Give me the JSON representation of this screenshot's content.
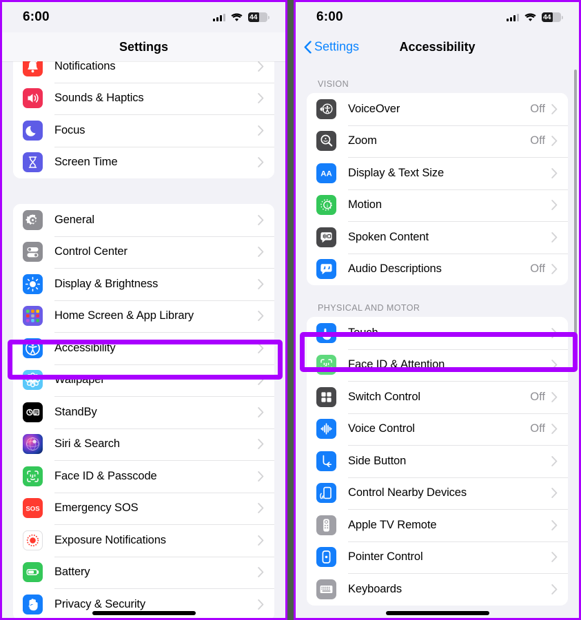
{
  "status_bar": {
    "time": "6:00",
    "battery_percent": "44",
    "signal_icon": "cellular-signal-icon",
    "wifi_icon": "wifi-icon",
    "battery_icon": "battery-icon"
  },
  "left_panel": {
    "title": "Settings",
    "highlighted_row": "Accessibility",
    "groups": [
      {
        "id": "group-notifications",
        "rows": [
          {
            "label": "Notifications",
            "icon": "bell-icon",
            "value": ""
          },
          {
            "label": "Sounds & Haptics",
            "icon": "speaker-icon",
            "value": ""
          },
          {
            "label": "Focus",
            "icon": "moon-icon",
            "value": ""
          },
          {
            "label": "Screen Time",
            "icon": "hourglass-icon",
            "value": ""
          }
        ]
      },
      {
        "id": "group-general",
        "rows": [
          {
            "label": "General",
            "icon": "gear-icon",
            "value": ""
          },
          {
            "label": "Control Center",
            "icon": "toggles-icon",
            "value": ""
          },
          {
            "label": "Display & Brightness",
            "icon": "sun-icon",
            "value": ""
          },
          {
            "label": "Home Screen & App Library",
            "icon": "app-grid-icon",
            "value": ""
          },
          {
            "label": "Accessibility",
            "icon": "accessibility-icon",
            "value": ""
          },
          {
            "label": "Wallpaper",
            "icon": "flower-icon",
            "value": ""
          },
          {
            "label": "StandBy",
            "icon": "standby-icon",
            "value": ""
          },
          {
            "label": "Siri & Search",
            "icon": "siri-icon",
            "value": ""
          },
          {
            "label": "Face ID & Passcode",
            "icon": "faceid-icon",
            "value": ""
          },
          {
            "label": "Emergency SOS",
            "icon": "sos-icon",
            "value": ""
          },
          {
            "label": "Exposure Notifications",
            "icon": "exposure-icon",
            "value": ""
          },
          {
            "label": "Battery",
            "icon": "battery-green-icon",
            "value": ""
          },
          {
            "label": "Privacy & Security",
            "icon": "hand-icon",
            "value": ""
          }
        ]
      }
    ]
  },
  "right_panel": {
    "back_label": "Settings",
    "title": "Accessibility",
    "highlighted_row": "Touch",
    "sections": [
      {
        "header": "VISION",
        "rows": [
          {
            "label": "VoiceOver",
            "icon": "voiceover-icon",
            "value": "Off"
          },
          {
            "label": "Zoom",
            "icon": "zoom-icon",
            "value": "Off"
          },
          {
            "label": "Display & Text Size",
            "icon": "aa-icon",
            "value": ""
          },
          {
            "label": "Motion",
            "icon": "motion-icon",
            "value": ""
          },
          {
            "label": "Spoken Content",
            "icon": "spoken-content-icon",
            "value": ""
          },
          {
            "label": "Audio Descriptions",
            "icon": "audio-desc-icon",
            "value": "Off"
          }
        ]
      },
      {
        "header": "PHYSICAL AND MOTOR",
        "rows": [
          {
            "label": "Touch",
            "icon": "touch-icon",
            "value": ""
          },
          {
            "label": "Face ID & Attention",
            "icon": "faceid-green-icon",
            "value": ""
          },
          {
            "label": "Switch Control",
            "icon": "switch-control-icon",
            "value": "Off"
          },
          {
            "label": "Voice Control",
            "icon": "voice-control-icon",
            "value": "Off"
          },
          {
            "label": "Side Button",
            "icon": "side-button-icon",
            "value": ""
          },
          {
            "label": "Control Nearby Devices",
            "icon": "nearby-devices-icon",
            "value": ""
          },
          {
            "label": "Apple TV Remote",
            "icon": "tv-remote-icon",
            "value": ""
          },
          {
            "label": "Pointer Control",
            "icon": "pointer-control-icon",
            "value": ""
          },
          {
            "label": "Keyboards",
            "icon": "keyboard-icon",
            "value": ""
          }
        ]
      }
    ]
  },
  "annotation": {
    "highlight_color": "#a900ff",
    "border_color": "#a900ff"
  }
}
